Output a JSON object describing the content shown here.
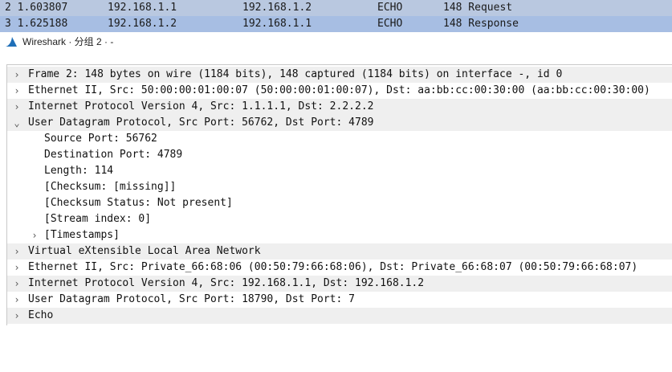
{
  "packet_list": {
    "rows": [
      {
        "no_time": "2 1.603807",
        "source": "192.168.1.1",
        "destination": "192.168.1.2",
        "protocol": "ECHO",
        "info": "148 Request"
      },
      {
        "no_time": "3 1.625188",
        "source": "192.168.1.2",
        "destination": "192.168.1.1",
        "protocol": "ECHO",
        "info": "148 Response"
      }
    ]
  },
  "window": {
    "title": "Wireshark · 分组 2 · -",
    "icon": "wireshark-fin-icon"
  },
  "details": {
    "rows": [
      {
        "text": "Frame 2: 148 bytes on wire (1184 bits), 148 captured (1184 bits) on interface -, id 0",
        "expander": "collapsed"
      },
      {
        "text": "Ethernet II, Src: 50:00:00:01:00:07 (50:00:00:01:00:07), Dst: aa:bb:cc:00:30:00 (aa:bb:cc:00:30:00)",
        "expander": "collapsed"
      },
      {
        "text": "Internet Protocol Version 4, Src: 1.1.1.1, Dst: 2.2.2.2",
        "expander": "collapsed"
      },
      {
        "text": "User Datagram Protocol, Src Port: 56762, Dst Port: 4789",
        "expander": "expanded"
      },
      {
        "text": "Source Port: 56762",
        "expander": "none"
      },
      {
        "text": "Destination Port: 4789",
        "expander": "none"
      },
      {
        "text": "Length: 114",
        "expander": "none"
      },
      {
        "text": "[Checksum: [missing]]",
        "expander": "none"
      },
      {
        "text": "[Checksum Status: Not present]",
        "expander": "none"
      },
      {
        "text": "[Stream index: 0]",
        "expander": "none"
      },
      {
        "text": "[Timestamps]",
        "expander": "collapsed"
      },
      {
        "text": "Virtual eXtensible Local Area Network",
        "expander": "collapsed"
      },
      {
        "text": "Ethernet II, Src: Private_66:68:06 (00:50:79:66:68:06), Dst: Private_66:68:07 (00:50:79:66:68:07)",
        "expander": "collapsed"
      },
      {
        "text": "Internet Protocol Version 4, Src: 192.168.1.1, Dst: 192.168.1.2",
        "expander": "collapsed"
      },
      {
        "text": "User Datagram Protocol, Src Port: 18790, Dst Port: 7",
        "expander": "collapsed"
      },
      {
        "text": "Echo",
        "expander": "collapsed"
      }
    ]
  },
  "icons": {
    "collapsed": "chevron-right-icon",
    "expanded": "chevron-down-icon"
  },
  "colors": {
    "selected_row": "#a7bee3",
    "other_row": "#b9c8e0",
    "band_row": "#efefef"
  }
}
